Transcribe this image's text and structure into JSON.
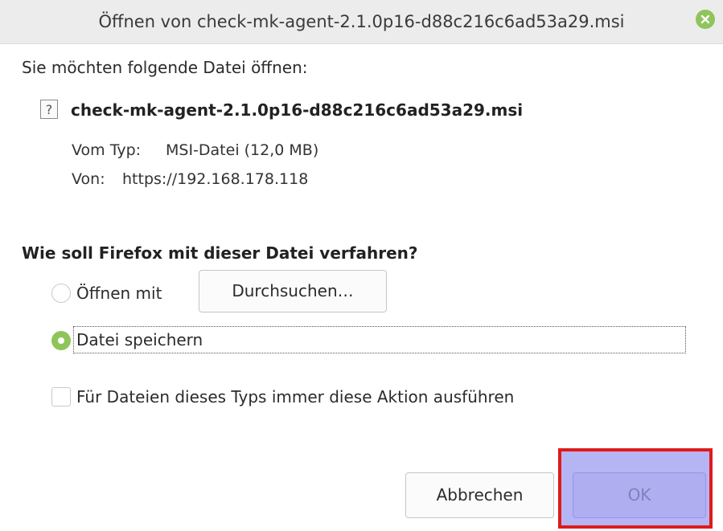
{
  "window": {
    "title": "Öffnen von check-mk-agent-2.1.0p16-d88c216c6ad53a29.msi",
    "close_icon": "close-icon"
  },
  "intro_text": "Sie möchten folgende Datei öffnen:",
  "file": {
    "icon": "unknown-file-icon",
    "icon_glyph": "?",
    "name": "check-mk-agent-2.1.0p16-d88c216c6ad53a29.msi",
    "type_label": "Vom Typ:",
    "type_value": "MSI-Datei (12,0 MB)",
    "from_label": "Von:",
    "from_value": "https://192.168.178.118"
  },
  "question": "Wie soll Firefox mit dieser Datei verfahren?",
  "options": {
    "open_with": {
      "label": "Öffnen mit",
      "selected": false
    },
    "browse_button": "Durchsuchen…",
    "save_file": {
      "label": "Datei speichern",
      "selected": true
    },
    "always_do": {
      "label": "Für Dateien dieses Typs immer diese Aktion ausführen",
      "checked": false
    }
  },
  "buttons": {
    "cancel": "Abbrechen",
    "ok": "OK"
  },
  "colors": {
    "accent": "#8fc45b",
    "highlight_border": "#e01a1a",
    "highlight_fill": "#7878eb"
  }
}
